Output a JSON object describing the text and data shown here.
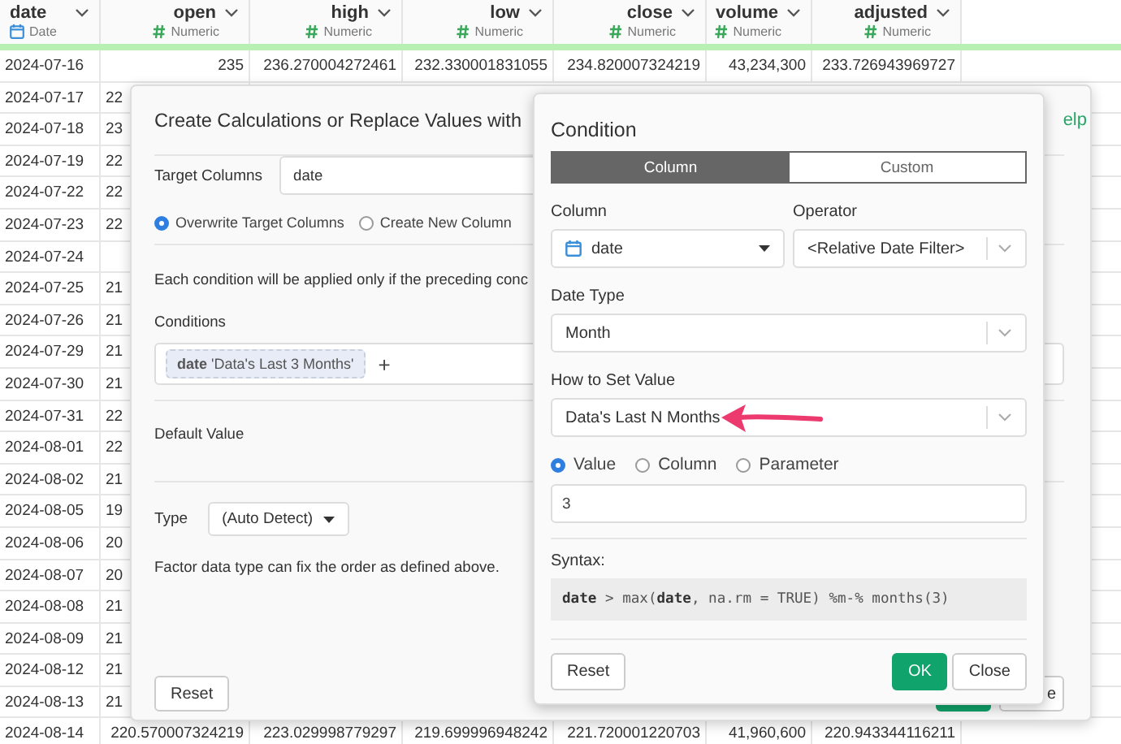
{
  "table": {
    "columns": [
      {
        "name": "date",
        "type": "Date",
        "kind": "date"
      },
      {
        "name": "open",
        "type": "Numeric",
        "kind": "numeric"
      },
      {
        "name": "high",
        "type": "Numeric",
        "kind": "numeric"
      },
      {
        "name": "low",
        "type": "Numeric",
        "kind": "numeric"
      },
      {
        "name": "close",
        "type": "Numeric",
        "kind": "numeric"
      },
      {
        "name": "volume",
        "type": "Numeric",
        "kind": "numeric"
      },
      {
        "name": "adjusted",
        "type": "Numeric",
        "kind": "numeric"
      }
    ],
    "rows": [
      {
        "kind": "full",
        "cells": [
          "2024-07-16",
          "235",
          "236.270004272461",
          "232.330001831055",
          "234.820007324219",
          "43,234,300",
          "233.726943969727"
        ]
      },
      {
        "kind": "partial",
        "cells": [
          "2024-07-17",
          "22"
        ]
      },
      {
        "kind": "partial",
        "cells": [
          "2024-07-18",
          "23"
        ]
      },
      {
        "kind": "partial",
        "cells": [
          "2024-07-19",
          "22"
        ]
      },
      {
        "kind": "partial",
        "cells": [
          "2024-07-22",
          "22"
        ]
      },
      {
        "kind": "partial",
        "cells": [
          "2024-07-23",
          "22"
        ]
      },
      {
        "kind": "partial",
        "cells": [
          "2024-07-24"
        ]
      },
      {
        "kind": "partial",
        "cells": [
          "2024-07-25",
          "21"
        ]
      },
      {
        "kind": "partial",
        "cells": [
          "2024-07-26",
          "21"
        ]
      },
      {
        "kind": "partial",
        "cells": [
          "2024-07-29",
          "21"
        ]
      },
      {
        "kind": "partial",
        "cells": [
          "2024-07-30",
          "21"
        ]
      },
      {
        "kind": "partial",
        "cells": [
          "2024-07-31",
          "22"
        ]
      },
      {
        "kind": "partial",
        "cells": [
          "2024-08-01",
          "22"
        ]
      },
      {
        "kind": "partial",
        "cells": [
          "2024-08-02",
          "21"
        ]
      },
      {
        "kind": "partial",
        "cells": [
          "2024-08-05",
          "19"
        ]
      },
      {
        "kind": "partial",
        "cells": [
          "2024-08-06",
          "20"
        ]
      },
      {
        "kind": "partial",
        "cells": [
          "2024-08-07",
          "20"
        ]
      },
      {
        "kind": "partial",
        "cells": [
          "2024-08-08",
          "21"
        ]
      },
      {
        "kind": "partial",
        "cells": [
          "2024-08-09",
          "21"
        ]
      },
      {
        "kind": "partial",
        "cells": [
          "2024-08-12",
          "21"
        ]
      },
      {
        "kind": "partial",
        "cells": [
          "2024-08-13",
          "21"
        ]
      },
      {
        "kind": "full",
        "cells": [
          "2024-08-14",
          "220.570007324219",
          "223.029998779297",
          "219.699996948242",
          "221.720001220703",
          "41,960,600",
          "220.943344116211"
        ]
      }
    ]
  },
  "dialog": {
    "title": "Create Calculations or Replace Values with",
    "help_link": "elp",
    "target_columns_label": "Target Columns",
    "target_columns_value": "date",
    "options": [
      {
        "label": "Overwrite Target Columns",
        "selected": true
      },
      {
        "label": "Create New Column",
        "selected": false
      }
    ],
    "note": "Each condition will be applied only if the preceding conc",
    "conditions_label": "Conditions",
    "conditions": [
      {
        "column": "date",
        "value": "'Data's Last 3 Months'"
      }
    ],
    "add_symbol": "+",
    "default_value_label": "Default Value",
    "type_label": "Type",
    "type_value": "(Auto Detect)",
    "factor_note": "Factor data type can fix the order as defined above.",
    "reset_button": "Reset",
    "close_button": "e"
  },
  "condition": {
    "title": "Condition",
    "tabs": [
      {
        "label": "Column",
        "selected": true
      },
      {
        "label": "Custom",
        "selected": false
      }
    ],
    "column_label": "Column",
    "column_value": "date",
    "operator_label": "Operator",
    "operator_value": "<Relative Date Filter>",
    "date_type_label": "Date Type",
    "date_type_value": "Month",
    "how_label": "How to Set Value",
    "how_value": "Data's Last N Months",
    "value_options": [
      {
        "label": "Value",
        "selected": true
      },
      {
        "label": "Column",
        "selected": false
      },
      {
        "label": "Parameter",
        "selected": false
      }
    ],
    "value_input": "3",
    "syntax_label": "Syntax:",
    "syntax_code": "**date** > max(**date**, na.rm = TRUE) %m-% months(3)",
    "reset_button": "Reset",
    "ok_button": "OK",
    "close_button": "Close"
  }
}
